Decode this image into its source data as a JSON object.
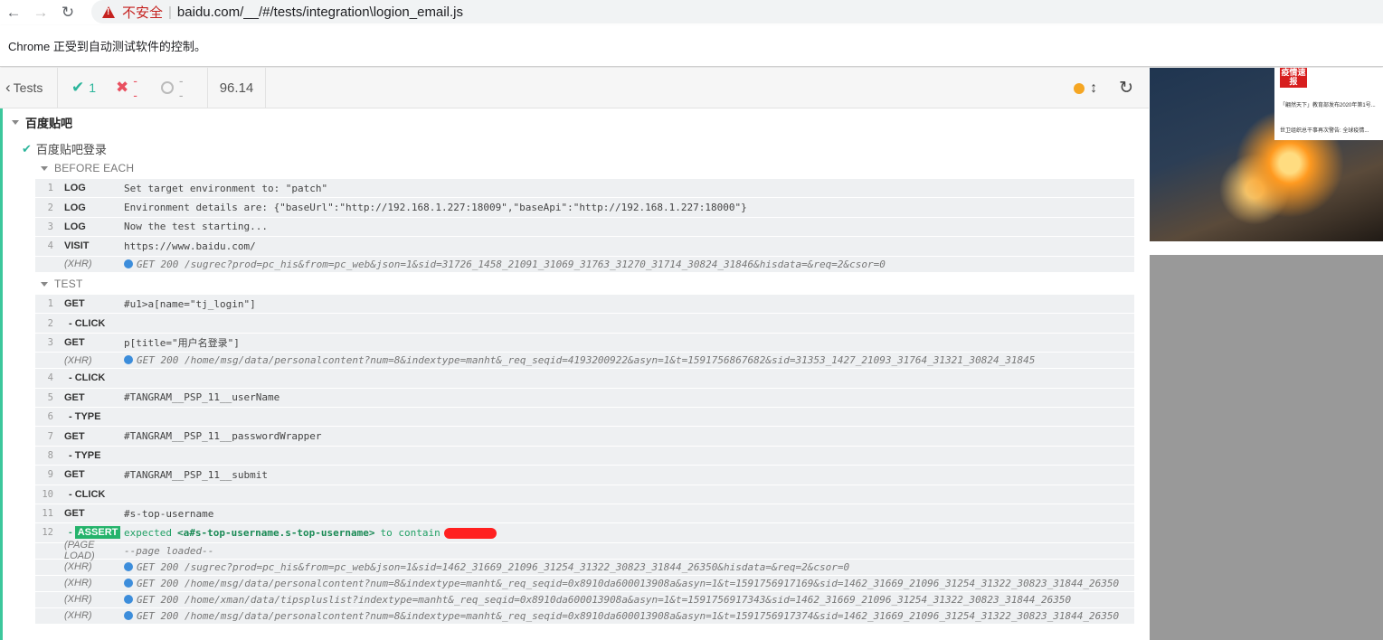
{
  "browser": {
    "insecure_label": "不安全",
    "url": "baidu.com/__/#/tests/integration\\logion_email.js",
    "infobar": "Chrome 正受到自动测试软件的控制。"
  },
  "header": {
    "tests_label": "Tests",
    "passed": "1",
    "failed": "--",
    "pending": "--",
    "duration": "96.14"
  },
  "suite": {
    "title": "百度贴吧",
    "test_title": "百度贴吧登录",
    "before_each_label": "BEFORE EACH",
    "test_label": "TEST",
    "before_each": [
      {
        "num": "1",
        "name": "LOG",
        "msg": "Set target environment to: \"patch\""
      },
      {
        "num": "2",
        "name": "LOG",
        "msg": "Environment details are: {\"baseUrl\":\"http://192.168.1.227:18009\",\"baseApi\":\"http://192.168.1.227:18000\"}"
      },
      {
        "num": "3",
        "name": "LOG",
        "msg": "Now the test starting..."
      },
      {
        "num": "4",
        "name": "VISIT",
        "msg": "https://www.baidu.com/"
      },
      {
        "num": "",
        "name": "(XHR)",
        "msg": "GET 200 /sugrec?prod=pc_his&from=pc_web&json=1&sid=31726_1458_21091_31069_31763_31270_31714_30824_31846&hisdata=&req=2&csor=0"
      }
    ],
    "test": [
      {
        "num": "1",
        "name": "GET",
        "msg": "#u1>a[name=\"tj_login\"]"
      },
      {
        "num": "2",
        "name": "- CLICK",
        "msg": ""
      },
      {
        "num": "3",
        "name": "GET",
        "msg": "p[title=\"用户名登录\"]"
      },
      {
        "num": "",
        "name": "(XHR)",
        "msg": "GET 200 /home/msg/data/personalcontent?num=8&indextype=manht&_req_seqid=4193200922&asyn=1&t=1591756867682&sid=31353_1427_21093_31764_31321_30824_31845"
      },
      {
        "num": "4",
        "name": "- CLICK",
        "msg": ""
      },
      {
        "num": "5",
        "name": "GET",
        "msg": "#TANGRAM__PSP_11__userName"
      },
      {
        "num": "6",
        "name": "- TYPE",
        "msg": ""
      },
      {
        "num": "7",
        "name": "GET",
        "msg": "#TANGRAM__PSP_11__passwordWrapper"
      },
      {
        "num": "8",
        "name": "- TYPE",
        "msg": ""
      },
      {
        "num": "9",
        "name": "GET",
        "msg": "#TANGRAM__PSP_11__submit"
      },
      {
        "num": "10",
        "name": "- CLICK",
        "msg": ""
      },
      {
        "num": "11",
        "name": "GET",
        "msg": "#s-top-username"
      },
      {
        "num": "12",
        "name": "- ASSERT",
        "msg_prefix": "expected",
        "msg_subject": "<a#s-top-username.s-top-username>",
        "msg_suffix": "to contain"
      },
      {
        "num": "",
        "name": "(PAGE LOAD)",
        "msg": "--page loaded--"
      },
      {
        "num": "",
        "name": "(XHR)",
        "msg": "GET 200 /sugrec?prod=pc_his&from=pc_web&json=1&sid=1462_31669_21096_31254_31322_30823_31844_26350&hisdata=&req=2&csor=0"
      },
      {
        "num": "",
        "name": "(XHR)",
        "msg": "GET 200 /home/msg/data/personalcontent?num=8&indextype=manht&_req_seqid=0x8910da600013908a&asyn=1&t=1591756917169&sid=1462_31669_21096_31254_31322_30823_31844_26350"
      },
      {
        "num": "",
        "name": "(XHR)",
        "msg": "GET 200 /home/xman/data/tipspluslist?indextype=manht&_req_seqid=0x8910da600013908a&asyn=1&t=1591756917343&sid=1462_31669_21096_31254_31322_30823_31844_26350"
      },
      {
        "num": "",
        "name": "(XHR)",
        "msg": "GET 200 /home/msg/data/personalcontent?num=8&indextype=manht&_req_seqid=0x8910da600013908a&asyn=1&t=1591756917374&sid=1462_31669_21096_31254_31322_30823_31844_26350"
      }
    ]
  },
  "preview": {
    "badge": "疫情速报",
    "news_1": "「翩然天下」教育部发布2020年第1号...",
    "news_2": "世卫组织总干事再次警告: 全球疫情..."
  },
  "colors": {
    "pass": "#2bb59b",
    "fail": "#e94f5f",
    "running_dot": "#f5a623",
    "assert": "#24b36b",
    "xhr_dot": "#3c8ddb"
  }
}
